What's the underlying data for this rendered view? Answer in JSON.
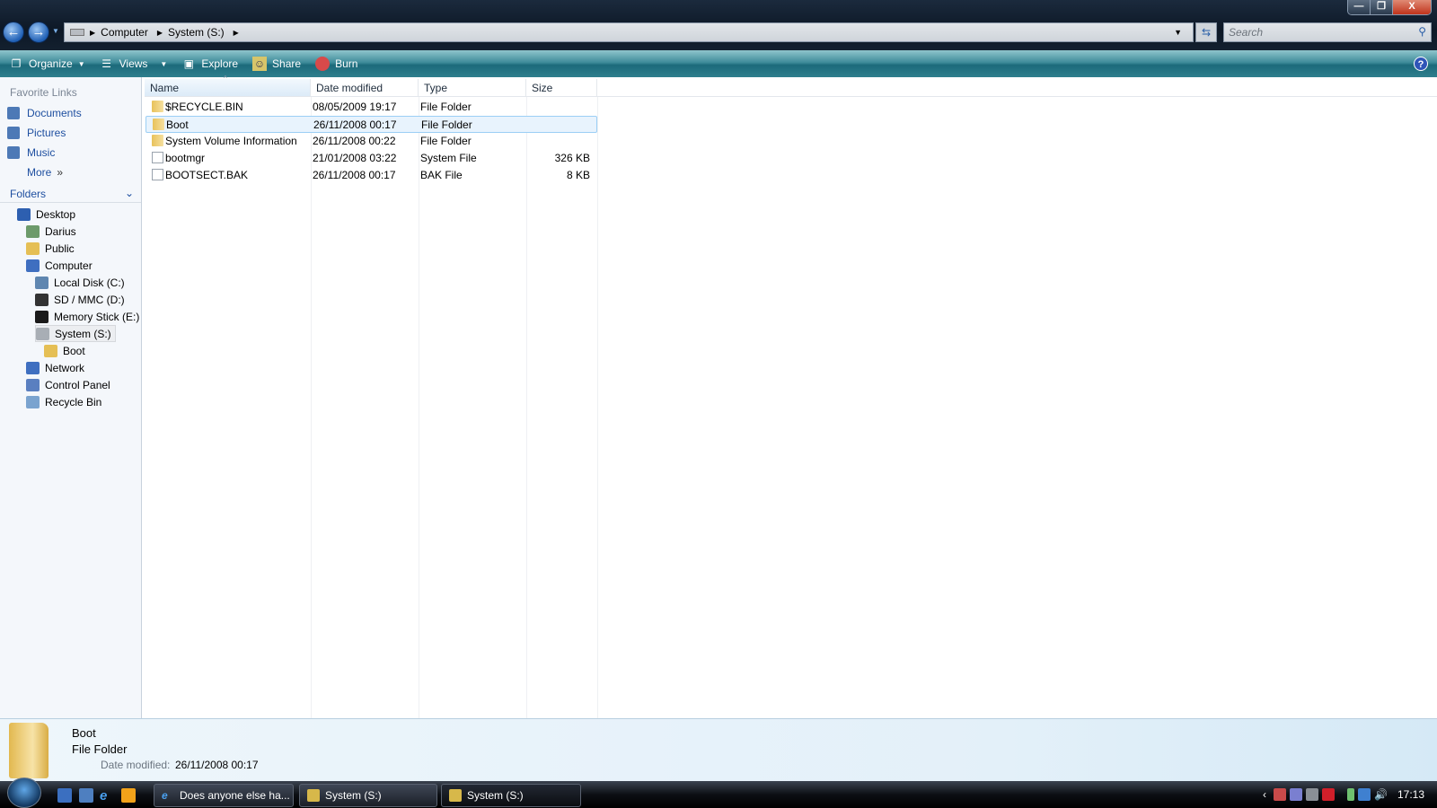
{
  "window": {
    "minimize": "—",
    "maximize": "❐",
    "close": "X"
  },
  "address": {
    "crumbs": [
      "Computer",
      "System (S:)"
    ],
    "search_placeholder": "Search"
  },
  "toolbar": {
    "organize": "Organize",
    "views": "Views",
    "explore": "Explore",
    "share": "Share",
    "burn": "Burn",
    "help": "?"
  },
  "favorites": {
    "title": "Favorite Links",
    "items": [
      "Documents",
      "Pictures",
      "Music"
    ],
    "more": "More"
  },
  "folders": {
    "title": "Folders",
    "tree": [
      {
        "label": "Desktop",
        "depth": 0,
        "color": "#2d5fb0"
      },
      {
        "label": "Darius",
        "depth": 1,
        "color": "#6c9a6a"
      },
      {
        "label": "Public",
        "depth": 1,
        "color": "#e5bf55"
      },
      {
        "label": "Computer",
        "depth": 1,
        "color": "#3f6fc0"
      },
      {
        "label": "Local Disk (C:)",
        "depth": 2,
        "color": "#5f86b0"
      },
      {
        "label": "SD / MMC (D:)",
        "depth": 2,
        "color": "#333333"
      },
      {
        "label": "Memory Stick (E:)",
        "depth": 2,
        "color": "#1a1a1a"
      },
      {
        "label": "System (S:)",
        "depth": 2,
        "color": "#a8aeb5",
        "selected": true
      },
      {
        "label": "Boot",
        "depth": 3,
        "color": "#e5bf55"
      },
      {
        "label": "Network",
        "depth": 1,
        "color": "#3f6fc0"
      },
      {
        "label": "Control Panel",
        "depth": 1,
        "color": "#5a7fc0"
      },
      {
        "label": "Recycle Bin",
        "depth": 1,
        "color": "#7aa3cf"
      }
    ]
  },
  "columns": [
    "Name",
    "Date modified",
    "Type",
    "Size"
  ],
  "files": [
    {
      "name": "$RECYCLE.BIN",
      "date": "08/05/2009 19:17",
      "type": "File Folder",
      "size": "",
      "kind": "folder"
    },
    {
      "name": "Boot",
      "date": "26/11/2008 00:17",
      "type": "File Folder",
      "size": "",
      "kind": "folder",
      "selected": true
    },
    {
      "name": "System Volume Information",
      "date": "26/11/2008 00:22",
      "type": "File Folder",
      "size": "",
      "kind": "folder"
    },
    {
      "name": "bootmgr",
      "date": "21/01/2008 03:22",
      "type": "System File",
      "size": "326 KB",
      "kind": "file"
    },
    {
      "name": "BOOTSECT.BAK",
      "date": "26/11/2008 00:17",
      "type": "BAK File",
      "size": "8 KB",
      "kind": "file"
    }
  ],
  "details": {
    "name": "Boot",
    "type": "File Folder",
    "date_label": "Date modified:",
    "date": "26/11/2008 00:17"
  },
  "taskbar": {
    "tasks": [
      "Does anyone else ha...",
      "System (S:)",
      "System (S:)"
    ],
    "clock": "17:13"
  }
}
